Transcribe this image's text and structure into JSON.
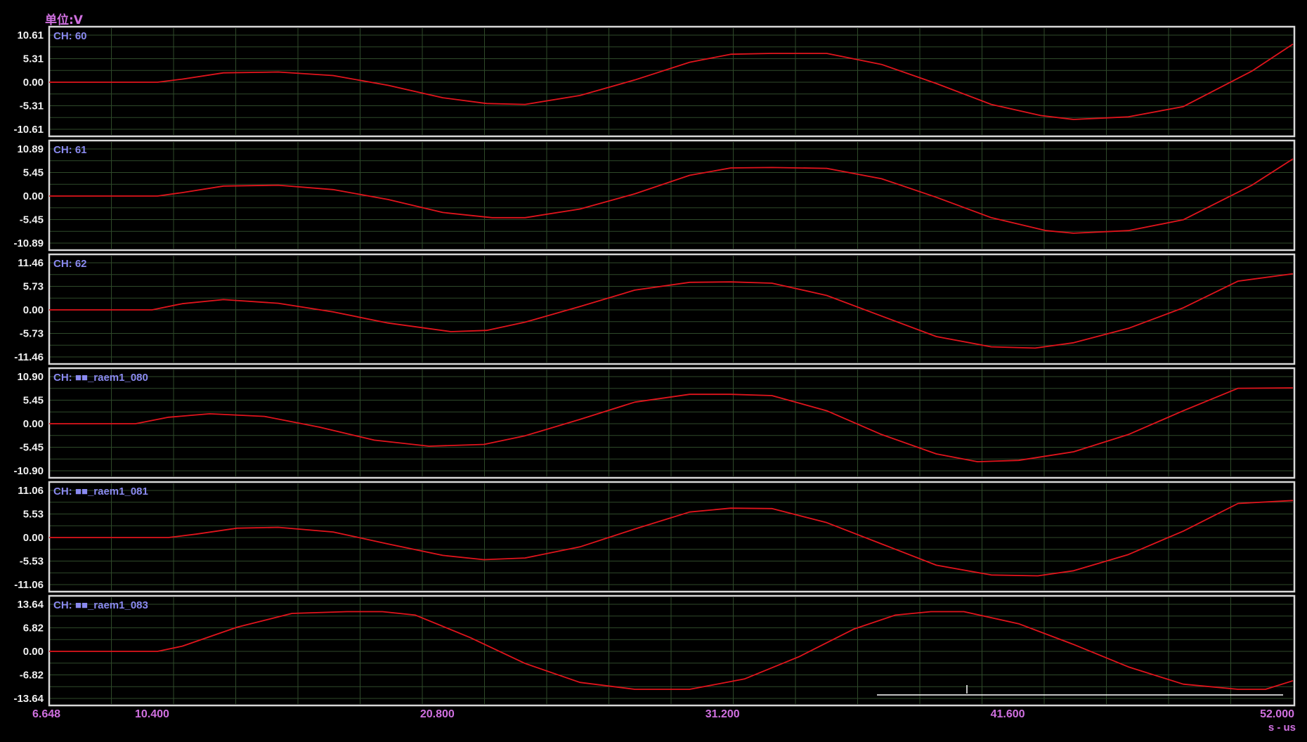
{
  "unit_label": "单位:V",
  "x_unit_label": "s - us",
  "colors": {
    "background": "#000000",
    "frame": "#d8d8d8",
    "grid": "#2f4a2a",
    "trace": "#e0141c",
    "y_tick_text": "#f0f0f0",
    "x_tick_text": "#d070e0",
    "channel_label": "#8a8af0"
  },
  "chart_data": [
    {
      "type": "line",
      "channel_label": "CH: 60",
      "ylim": [
        -10.61,
        10.61
      ],
      "y_ticks": [
        "10.61",
        "5.31",
        "0.00",
        "-5.31",
        "-10.61"
      ],
      "xlim": [
        6.648,
        52.0
      ],
      "grid": true,
      "series": [
        {
          "x": [
            6.648,
            10.6,
            11.5,
            13.0,
            15.0,
            17.0,
            19.0,
            21.0,
            22.6,
            24.0,
            26.0,
            28.0,
            30.0,
            31.5,
            33.0,
            35.0,
            37.0,
            39.0,
            41.0,
            42.8,
            44.0,
            46.0,
            48.0,
            50.5,
            52.0
          ],
          "y": [
            0,
            0,
            0.7,
            2.1,
            2.3,
            1.5,
            -0.7,
            -3.5,
            -4.8,
            -5.0,
            -3.0,
            0.5,
            4.5,
            6.3,
            6.5,
            6.5,
            4.0,
            -0.3,
            -5.0,
            -7.5,
            -8.4,
            -7.8,
            -5.5,
            2.5,
            8.6
          ]
        }
      ]
    },
    {
      "type": "line",
      "channel_label": "CH: 61",
      "ylim": [
        -10.89,
        10.89
      ],
      "y_ticks": [
        "10.89",
        "5.45",
        "0.00",
        "-5.45",
        "-10.89"
      ],
      "xlim": [
        6.648,
        52.0
      ],
      "grid": true,
      "series": [
        {
          "x": [
            6.648,
            10.6,
            11.5,
            13.0,
            15.0,
            17.0,
            19.0,
            21.0,
            22.8,
            24.0,
            26.0,
            28.0,
            30.0,
            31.5,
            33.0,
            35.0,
            37.0,
            39.0,
            41.0,
            43.0,
            44.0,
            46.0,
            48.0,
            50.5,
            52.0
          ],
          "y": [
            0,
            0,
            0.8,
            2.3,
            2.5,
            1.5,
            -0.8,
            -3.8,
            -5.0,
            -5.0,
            -3.0,
            0.5,
            4.8,
            6.5,
            6.6,
            6.4,
            4.0,
            -0.3,
            -5.0,
            -8.0,
            -8.6,
            -8.0,
            -5.5,
            2.5,
            8.6
          ]
        }
      ]
    },
    {
      "type": "line",
      "channel_label": "CH: 62",
      "ylim": [
        -11.46,
        11.46
      ],
      "y_ticks": [
        "11.46",
        "5.73",
        "0.00",
        "-5.73",
        "-11.46"
      ],
      "xlim": [
        6.648,
        52.0
      ],
      "grid": true,
      "series": [
        {
          "x": [
            6.648,
            10.4,
            11.5,
            13.0,
            15.0,
            17.0,
            19.0,
            21.3,
            22.6,
            24.0,
            26.0,
            28.0,
            30.0,
            31.5,
            33.0,
            35.0,
            37.0,
            39.0,
            41.0,
            42.6,
            44.0,
            46.0,
            48.0,
            50.0,
            52.0
          ],
          "y": [
            0,
            0,
            1.5,
            2.5,
            1.6,
            -0.5,
            -3.2,
            -5.3,
            -5.0,
            -3.0,
            0.8,
            4.8,
            6.7,
            6.8,
            6.5,
            3.5,
            -1.5,
            -6.5,
            -9.0,
            -9.3,
            -8.0,
            -4.5,
            0.5,
            7.0,
            8.8
          ]
        }
      ]
    },
    {
      "type": "line",
      "channel_label": "CH: ■■_raem1_080",
      "ylim": [
        -10.9,
        10.9
      ],
      "y_ticks": [
        "10.90",
        "5.45",
        "0.00",
        "-5.45",
        "-10.90"
      ],
      "xlim": [
        6.648,
        52.0
      ],
      "grid": true,
      "series": [
        {
          "x": [
            6.648,
            9.8,
            11.0,
            12.5,
            14.5,
            16.5,
            18.5,
            20.5,
            22.5,
            24.0,
            26.0,
            28.0,
            30.0,
            31.5,
            33.0,
            35.0,
            37.0,
            39.0,
            40.5,
            42.0,
            44.0,
            46.0,
            48.0,
            50.0,
            52.0
          ],
          "y": [
            0,
            0,
            1.5,
            2.3,
            1.7,
            -0.8,
            -3.8,
            -5.2,
            -4.8,
            -2.8,
            1.0,
            5.0,
            6.8,
            6.8,
            6.5,
            3.0,
            -2.5,
            -7.0,
            -8.8,
            -8.5,
            -6.5,
            -2.5,
            3.0,
            8.2,
            8.3
          ]
        }
      ]
    },
    {
      "type": "line",
      "channel_label": "CH: ■■_raem1_081",
      "ylim": [
        -11.06,
        11.06
      ],
      "y_ticks": [
        "11.06",
        "5.53",
        "0.00",
        "-5.53",
        "-11.06"
      ],
      "xlim": [
        6.648,
        52.0
      ],
      "grid": true,
      "series": [
        {
          "x": [
            6.648,
            11.0,
            12.0,
            13.5,
            15.0,
            17.0,
            19.0,
            21.0,
            22.5,
            24.0,
            26.0,
            28.0,
            30.0,
            31.5,
            33.0,
            35.0,
            37.0,
            39.0,
            41.0,
            42.7,
            44.0,
            46.0,
            48.0,
            50.0,
            52.0
          ],
          "y": [
            0,
            0,
            0.8,
            2.2,
            2.4,
            1.3,
            -1.5,
            -4.2,
            -5.2,
            -4.8,
            -2.2,
            2.0,
            6.0,
            6.9,
            6.8,
            3.5,
            -1.5,
            -6.5,
            -8.8,
            -9.0,
            -7.8,
            -4.0,
            1.5,
            8.0,
            8.7
          ]
        }
      ]
    },
    {
      "type": "line",
      "channel_label": "CH: ■■_raem1_083",
      "ylim": [
        -13.64,
        13.64
      ],
      "y_ticks": [
        "13.64",
        "6.82",
        "0.00",
        "-6.82",
        "-13.64"
      ],
      "xlim": [
        6.648,
        52.0
      ],
      "grid": true,
      "series": [
        {
          "x": [
            6.648,
            10.6,
            11.5,
            13.5,
            15.5,
            17.5,
            18.8,
            20.0,
            22.0,
            24.0,
            26.0,
            28.0,
            30.0,
            32.0,
            34.0,
            36.0,
            37.5,
            38.8,
            40.0,
            42.0,
            44.0,
            46.0,
            48.0,
            50.0,
            51.0,
            52.0
          ],
          "y": [
            0,
            0,
            1.5,
            7.0,
            11.0,
            11.5,
            11.5,
            10.5,
            4.0,
            -3.5,
            -9.0,
            -11.0,
            -11.0,
            -8.0,
            -1.5,
            6.5,
            10.5,
            11.5,
            11.5,
            8.0,
            2.0,
            -4.5,
            -9.5,
            -11.0,
            -11.0,
            -8.5
          ]
        }
      ]
    }
  ],
  "x_axis": {
    "tick_labels": [
      "6.648",
      "10.400",
      "20.800",
      "31.200",
      "41.600",
      "52.000"
    ],
    "tick_values": [
      6.648,
      10.4,
      20.8,
      31.2,
      41.6,
      52.0
    ]
  }
}
